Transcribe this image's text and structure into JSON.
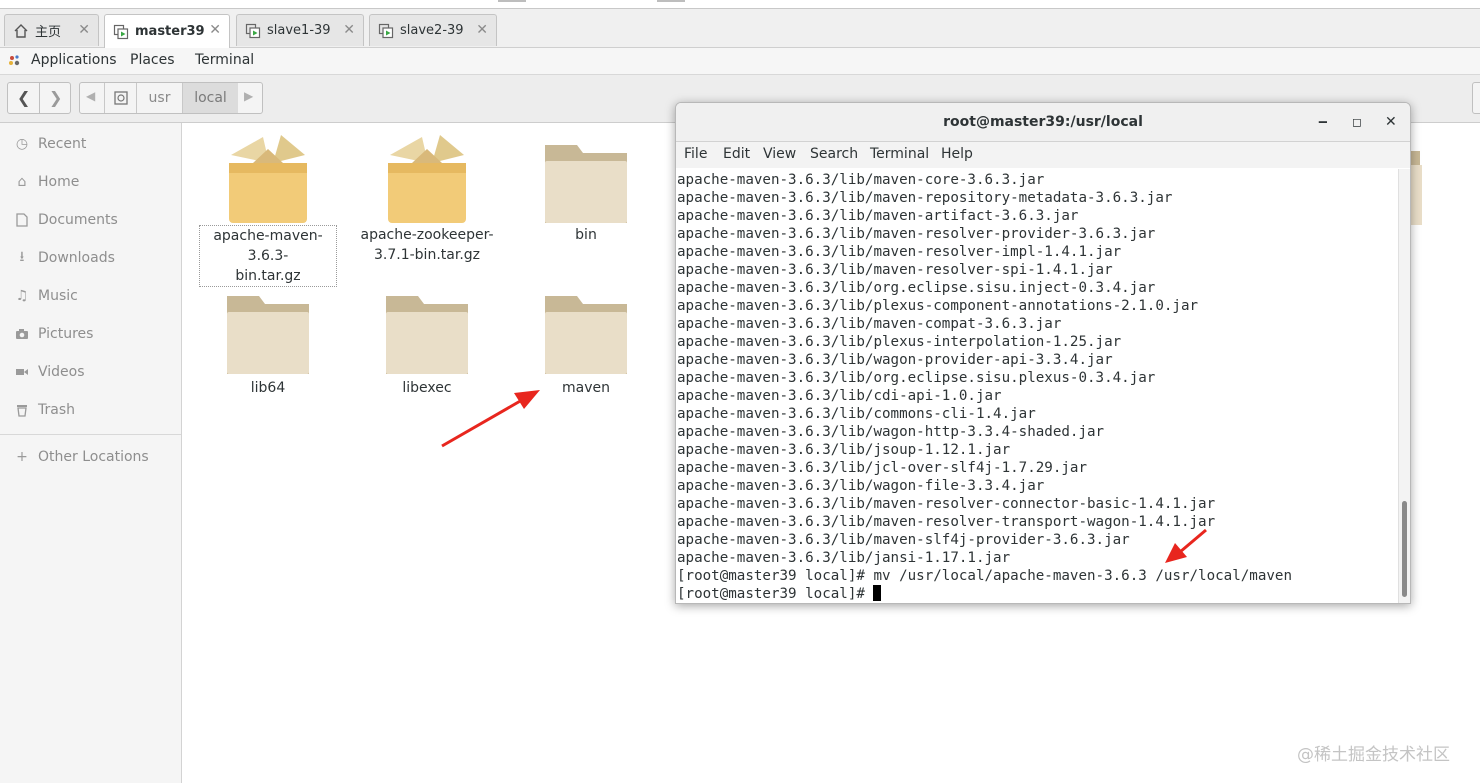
{
  "vm_tabs": [
    {
      "label": "主页",
      "icon": "home-icon",
      "active": false
    },
    {
      "label": "master39",
      "icon": "vm-icon",
      "active": true
    },
    {
      "label": "slave1-39",
      "icon": "vm-icon",
      "active": false
    },
    {
      "label": "slave2-39",
      "icon": "vm-icon",
      "active": false
    }
  ],
  "top_menu": {
    "applications": "Applications",
    "places": "Places",
    "terminal": "Terminal"
  },
  "breadcrumb": {
    "usr": "usr",
    "local": "local"
  },
  "sidebar": {
    "items": [
      {
        "label": "Recent",
        "icon": "clock-icon"
      },
      {
        "label": "Home",
        "icon": "home-icon"
      },
      {
        "label": "Documents",
        "icon": "document-icon"
      },
      {
        "label": "Downloads",
        "icon": "download-icon"
      },
      {
        "label": "Music",
        "icon": "music-icon"
      },
      {
        "label": "Pictures",
        "icon": "camera-icon"
      },
      {
        "label": "Videos",
        "icon": "video-icon"
      },
      {
        "label": "Trash",
        "icon": "trash-icon"
      }
    ],
    "other_locations": "Other Locations"
  },
  "files": [
    {
      "label_line1": "apache-maven-3.6.3-",
      "label_line2": "bin.tar.gz",
      "type": "archive",
      "selected": true
    },
    {
      "label_line1": "apache-zookeeper-",
      "label_line2": "3.7.1-bin.tar.gz",
      "type": "archive",
      "selected": false
    },
    {
      "label_line1": "bin",
      "label_line2": "",
      "type": "folder",
      "selected": false
    },
    {
      "label_line1": "lib64",
      "label_line2": "",
      "type": "folder",
      "selected": false
    },
    {
      "label_line1": "libexec",
      "label_line2": "",
      "type": "folder",
      "selected": false
    },
    {
      "label_line1": "maven",
      "label_line2": "",
      "type": "folder",
      "selected": false
    }
  ],
  "terminal": {
    "title": "root@master39:/usr/local",
    "menu": {
      "file": "File",
      "edit": "Edit",
      "view": "View",
      "search": "Search",
      "terminal": "Terminal",
      "help": "Help"
    },
    "lines": [
      "apache-maven-3.6.3/lib/maven-core-3.6.3.jar",
      "apache-maven-3.6.3/lib/maven-repository-metadata-3.6.3.jar",
      "apache-maven-3.6.3/lib/maven-artifact-3.6.3.jar",
      "apache-maven-3.6.3/lib/maven-resolver-provider-3.6.3.jar",
      "apache-maven-3.6.3/lib/maven-resolver-impl-1.4.1.jar",
      "apache-maven-3.6.3/lib/maven-resolver-spi-1.4.1.jar",
      "apache-maven-3.6.3/lib/org.eclipse.sisu.inject-0.3.4.jar",
      "apache-maven-3.6.3/lib/plexus-component-annotations-2.1.0.jar",
      "apache-maven-3.6.3/lib/maven-compat-3.6.3.jar",
      "apache-maven-3.6.3/lib/plexus-interpolation-1.25.jar",
      "apache-maven-3.6.3/lib/wagon-provider-api-3.3.4.jar",
      "apache-maven-3.6.3/lib/org.eclipse.sisu.plexus-0.3.4.jar",
      "apache-maven-3.6.3/lib/cdi-api-1.0.jar",
      "apache-maven-3.6.3/lib/commons-cli-1.4.jar",
      "apache-maven-3.6.3/lib/wagon-http-3.3.4-shaded.jar",
      "apache-maven-3.6.3/lib/jsoup-1.12.1.jar",
      "apache-maven-3.6.3/lib/jcl-over-slf4j-1.7.29.jar",
      "apache-maven-3.6.3/lib/wagon-file-3.3.4.jar",
      "apache-maven-3.6.3/lib/maven-resolver-connector-basic-1.4.1.jar",
      "apache-maven-3.6.3/lib/maven-resolver-transport-wagon-1.4.1.jar",
      "apache-maven-3.6.3/lib/maven-slf4j-provider-3.6.3.jar",
      "apache-maven-3.6.3/lib/jansi-1.17.1.jar",
      "[root@master39 local]# mv /usr/local/apache-maven-3.6.3 /usr/local/maven"
    ],
    "prompt": "[root@master39 local]# "
  },
  "watermark": "@稀土掘金技术社区",
  "colors": {
    "annotation_arrow": "#e8261e",
    "folder": "#e8dcc4",
    "folder_tab": "#c8b896",
    "archive": "#f0c878"
  }
}
